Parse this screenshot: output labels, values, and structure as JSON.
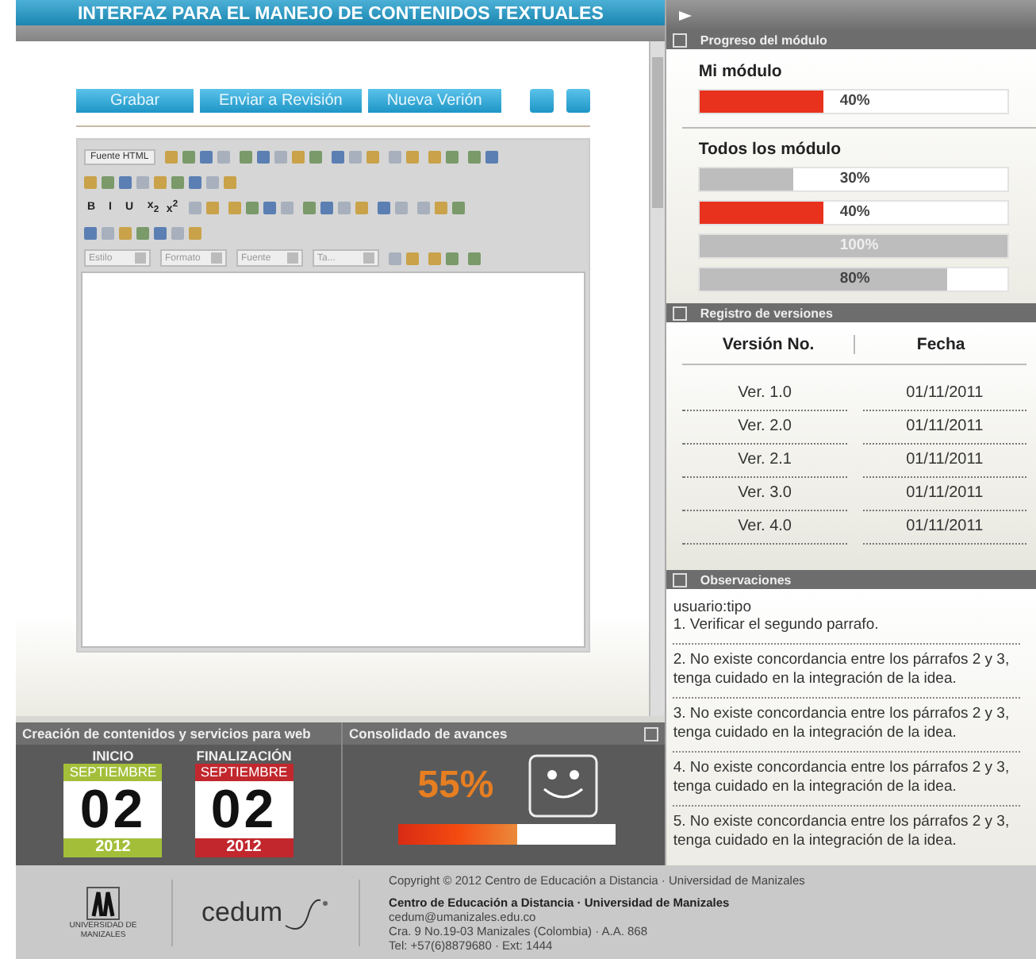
{
  "header": {
    "title": "INTERFAZ PARA EL MANEJO DE CONTENIDOS TEXTUALES"
  },
  "actions": [
    "Grabar",
    "Enviar a Revisión",
    "Nueva Verión"
  ],
  "toolbar": [
    [
      {
        "kind": "label",
        "text": "Fuente HTML"
      },
      {
        "kind": "icon"
      },
      {
        "kind": "icon"
      },
      {
        "kind": "icon"
      },
      {
        "kind": "icon"
      },
      {
        "kind": "icon"
      },
      {
        "kind": "icon"
      }
    ],
    [
      {
        "kind": "icon"
      }
    ],
    [
      {
        "kind": "glyph",
        "items": [
          "B",
          "I",
          "U"
        ]
      },
      {
        "kind": "glyph",
        "items": [
          "x$_{2}$",
          "x$^{2}$"
        ]
      },
      {
        "kind": "icon"
      },
      {
        "kind": "icon"
      },
      {
        "kind": "icon"
      },
      {
        "kind": "icon"
      },
      {
        "kind": "icon"
      }
    ],
    [
      {
        "kind": "icon"
      }
    ],
    [
      {
        "kind": "select",
        "text": "Estilo"
      },
      {
        "kind": "select",
        "text": "Formato"
      },
      {
        "kind": "select",
        "text": "Fuente"
      },
      {
        "kind": "select",
        "text": "Ta..."
      },
      {
        "kind": "icon"
      },
      {
        "kind": "icon"
      },
      {
        "kind": "icon"
      }
    ]
  ],
  "course": {
    "title": "Creación de contenidos y servicios para web",
    "dates": [
      {
        "label": "INICIO",
        "month": "SEPTIEMBRE",
        "day": "02",
        "year": "2012",
        "color": "#a3bf3a"
      },
      {
        "label": "FINALIZACIÓN",
        "month": "SEPTIEMBRE",
        "day": "02",
        "year": "2012",
        "color": "#c1272d"
      }
    ]
  },
  "summary": {
    "title": "Consolidado de avances",
    "percent": "55%",
    "level": 0.55
  },
  "progress": {
    "title": "Progreso del módulo",
    "mine_title": "Mi módulo",
    "mine": {
      "level": 0.4,
      "reading": "40%",
      "color": "#e8321e"
    },
    "all_title": "Todos los módulo",
    "all": [
      {
        "level": 0.3,
        "reading": "30%",
        "color": "#bdbdbd"
      },
      {
        "level": 0.4,
        "reading": "40%",
        "color": "#e8321e"
      },
      {
        "level": 1,
        "reading": "100%",
        "color": "#bdbdbd"
      },
      {
        "level": 0.8,
        "reading": "80%",
        "color": "#bdbdbd"
      }
    ]
  },
  "versions": {
    "title": "Registro de versiones",
    "columns": [
      "Versión No.",
      "Fecha"
    ],
    "rows": [
      [
        "Ver. 1.0",
        "01/11/2011"
      ],
      [
        "Ver. 2.0",
        "01/11/2011"
      ],
      [
        "Ver. 2.1",
        "01/11/2011"
      ],
      [
        "Ver. 3.0",
        "01/11/2011"
      ],
      [
        "Ver. 4.0",
        "01/11/2011"
      ]
    ]
  },
  "observations": {
    "title": "Observaciones",
    "user": "usuario:tipo",
    "items": [
      "1. Verificar el segundo parrafo.",
      "2. No existe concordancia entre los párrafos 2 y 3, tenga cuidado en la integración de la idea.",
      "3. No existe concordancia entre los párrafos 2 y 3, tenga cuidado en la integración de la idea.",
      "4. No existe concordancia entre los párrafos 2 y 3, tenga cuidado en la integración de la idea.",
      "5. No existe concordancia entre los párrafos 2 y 3, tenga cuidado en la integración de la idea."
    ]
  },
  "footer": {
    "university": "UNIVERSIDAD DE MANIZALES",
    "brand": "cedum",
    "copyright": "Copyright © 2012 Centro de Educación a Distancia · Universidad de Manizales",
    "org": "**Centro de Educación a Distancia · Universidad de Manizales**",
    "lines": [
      "cedum@umanizales.edu.co",
      "Cra. 9 No.19-03 Manizales (Colombia) · A.A. 868",
      "Tel: +57(6)8879680 · Ext: 1444"
    ]
  }
}
